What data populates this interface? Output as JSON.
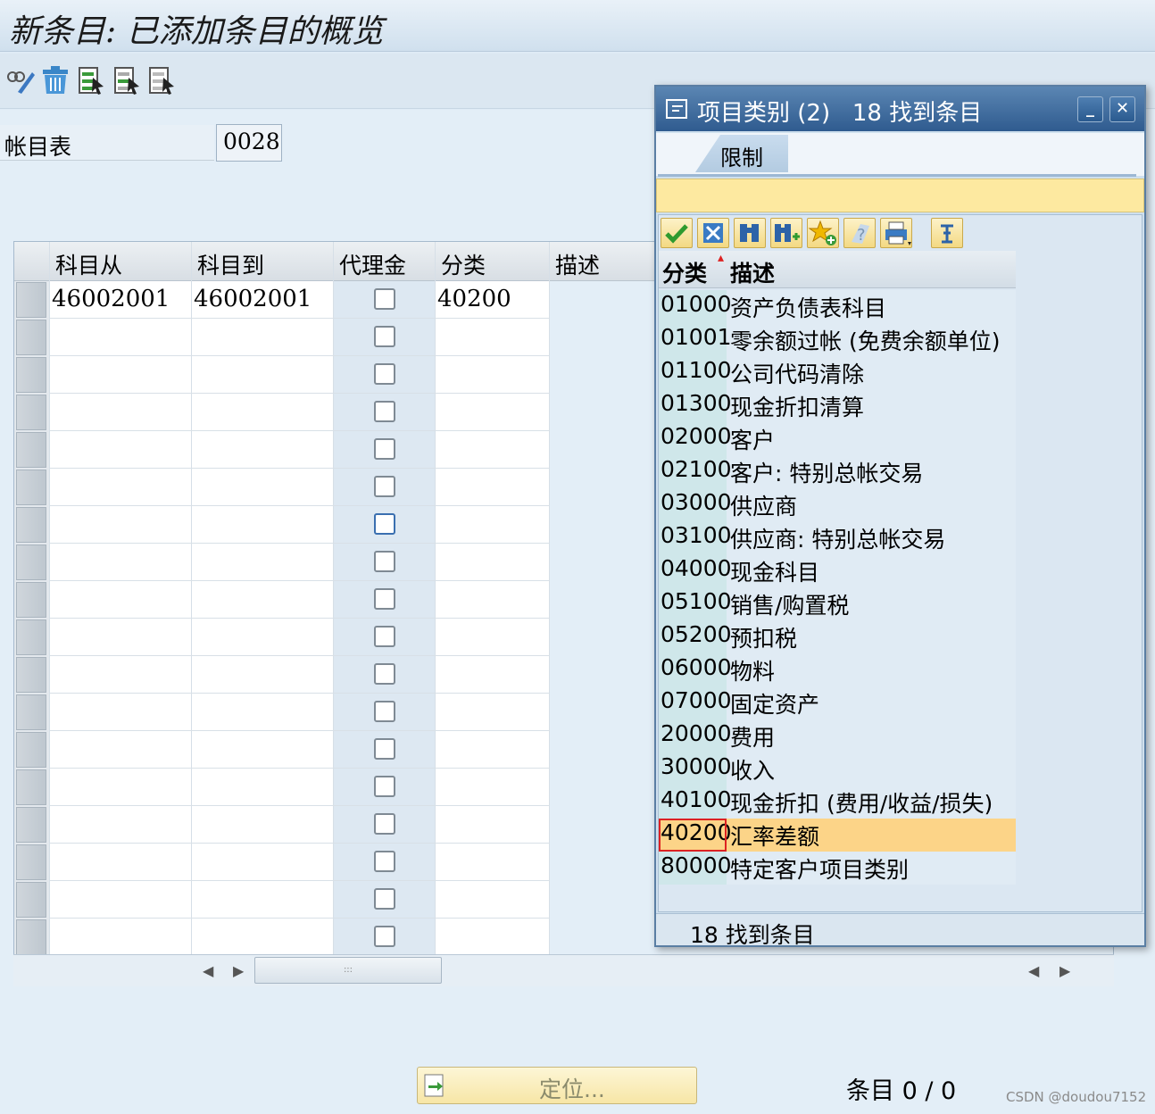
{
  "title": "新条目: 已添加条目的概览",
  "toolbar": {
    "icons": [
      "change-icon",
      "delete-icon",
      "select-all-icon",
      "select-block-icon",
      "deselect-all-icon"
    ]
  },
  "form": {
    "chart_label": "帐目表",
    "chart_value": "0028"
  },
  "table": {
    "headers": [
      "科目从",
      "科目到",
      "代理金",
      "分类",
      "描述"
    ],
    "row1": {
      "from": "46002001",
      "to": "46002001",
      "class": "40200"
    }
  },
  "locate_button": "定位...",
  "entries": "条目 0 / 0",
  "watermark": "CSDN @doudou7152",
  "popup": {
    "title": "项目类别 (2)   18 找到条目",
    "tab": "限制",
    "headers": {
      "code": "分类",
      "desc": "描述"
    },
    "rows": [
      {
        "code": "01000",
        "desc": "资产负债表科目"
      },
      {
        "code": "01001",
        "desc": "零余额过帐 (免费余额单位)"
      },
      {
        "code": "01100",
        "desc": "公司代码清除"
      },
      {
        "code": "01300",
        "desc": "现金折扣清算"
      },
      {
        "code": "02000",
        "desc": "客户"
      },
      {
        "code": "02100",
        "desc": "客户: 特别总帐交易"
      },
      {
        "code": "03000",
        "desc": "供应商"
      },
      {
        "code": "03100",
        "desc": "供应商: 特别总帐交易"
      },
      {
        "code": "04000",
        "desc": "现金科目"
      },
      {
        "code": "05100",
        "desc": "销售/购置税"
      },
      {
        "code": "05200",
        "desc": "预扣税"
      },
      {
        "code": "06000",
        "desc": "物料"
      },
      {
        "code": "07000",
        "desc": "固定资产"
      },
      {
        "code": "20000",
        "desc": "费用"
      },
      {
        "code": "30000",
        "desc": "收入"
      },
      {
        "code": "40100",
        "desc": "现金折扣 (费用/收益/损失)"
      },
      {
        "code": "40200",
        "desc": "汇率差额"
      },
      {
        "code": "80000",
        "desc": "特定客户项目类别"
      }
    ],
    "status": "18 找到条目"
  }
}
